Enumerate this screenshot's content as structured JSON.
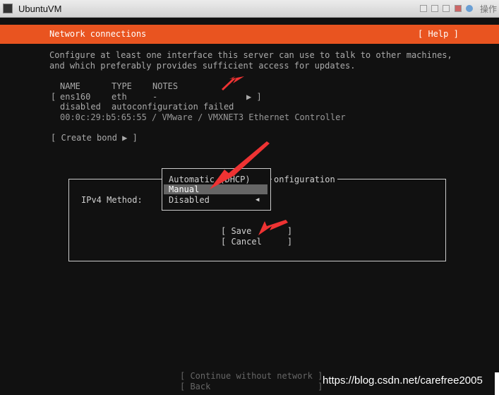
{
  "window": {
    "title": "UbuntuVM",
    "ops_label": "操作"
  },
  "header": {
    "title": "Network connections",
    "help": "[ Help ]"
  },
  "intro": [
    "Configure at least one interface this server can use to talk to other machines,",
    "and which preferably provides sufficient access for updates."
  ],
  "table": {
    "headers": [
      "NAME",
      "TYPE",
      "NOTES"
    ],
    "row": {
      "open": "[",
      "name": "ens160",
      "type": "eth",
      "notes": "-",
      "arrow": "▶ ]"
    },
    "status": {
      "state": "disabled",
      "note": "autoconfiguration failed"
    },
    "hw": "00:0c:29:b5:65:55 / VMware / VMXNET3 Ethernet Controller"
  },
  "create_bond": "[ Create bond ▶ ]",
  "dialog": {
    "title_fragment": "onfiguration",
    "ipv4_label": "IPv4 Method:",
    "options": [
      "Automatic (DHCP)",
      "Manual",
      "Disabled"
    ],
    "selected": "Manual",
    "current_marker": "◀",
    "save": "[ Save       ]",
    "cancel": "[ Cancel     ]"
  },
  "footer": {
    "continue": "[ Continue without network ]",
    "back": "[ Back                     ]"
  },
  "watermark": "https://blog.csdn.net/carefree2005",
  "colors": {
    "accent": "#e95420",
    "annotation": "#ee3333"
  }
}
